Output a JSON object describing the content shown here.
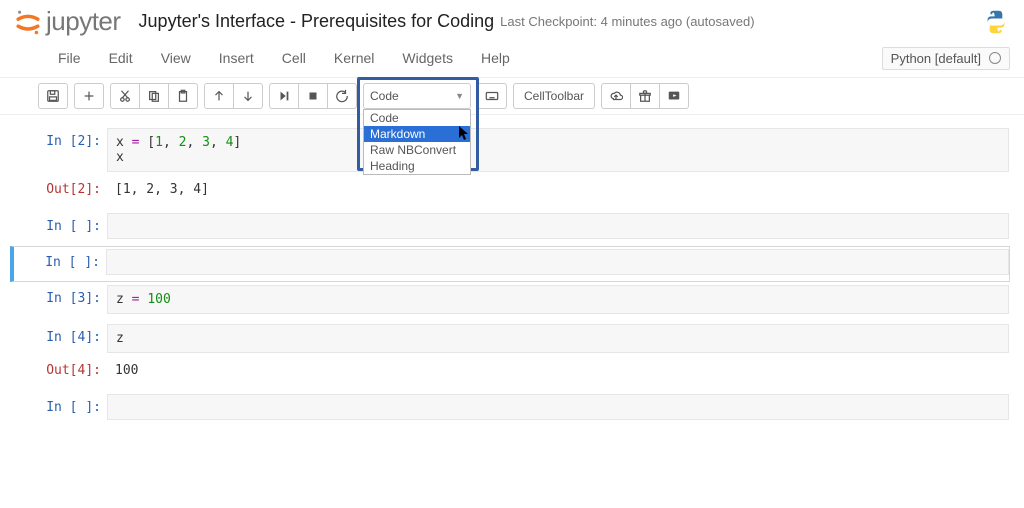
{
  "header": {
    "logo_text": "jupyter",
    "notebook_title": "Jupyter's Interface - Prerequisites for Coding",
    "checkpoint": "Last Checkpoint: 4 minutes ago (autosaved)"
  },
  "menubar": {
    "items": [
      "File",
      "Edit",
      "View",
      "Insert",
      "Cell",
      "Kernel",
      "Widgets",
      "Help"
    ],
    "kernel_label": "Python [default]"
  },
  "toolbar": {
    "celltype_selected": "Code",
    "celltype_options": [
      "Code",
      "Markdown",
      "Raw NBConvert",
      "Heading"
    ],
    "celltype_highlighted": "Markdown",
    "celltoolbar_label": "CellToolbar"
  },
  "cells": [
    {
      "type": "code",
      "in_prompt": "In [2]:",
      "source": "x = [1, 2, 3, 4]\nx",
      "out_prompt": "Out[2]:",
      "output": "[1, 2, 3, 4]"
    },
    {
      "type": "code",
      "in_prompt": "In [ ]:",
      "source": ""
    },
    {
      "type": "code",
      "in_prompt": "In [ ]:",
      "source": "",
      "selected": true
    },
    {
      "type": "code",
      "in_prompt": "In [3]:",
      "source": "z = 100"
    },
    {
      "type": "code",
      "in_prompt": "In [4]:",
      "source": "z",
      "out_prompt": "Out[4]:",
      "output": "100"
    },
    {
      "type": "code",
      "in_prompt": "In [ ]:",
      "source": ""
    }
  ]
}
